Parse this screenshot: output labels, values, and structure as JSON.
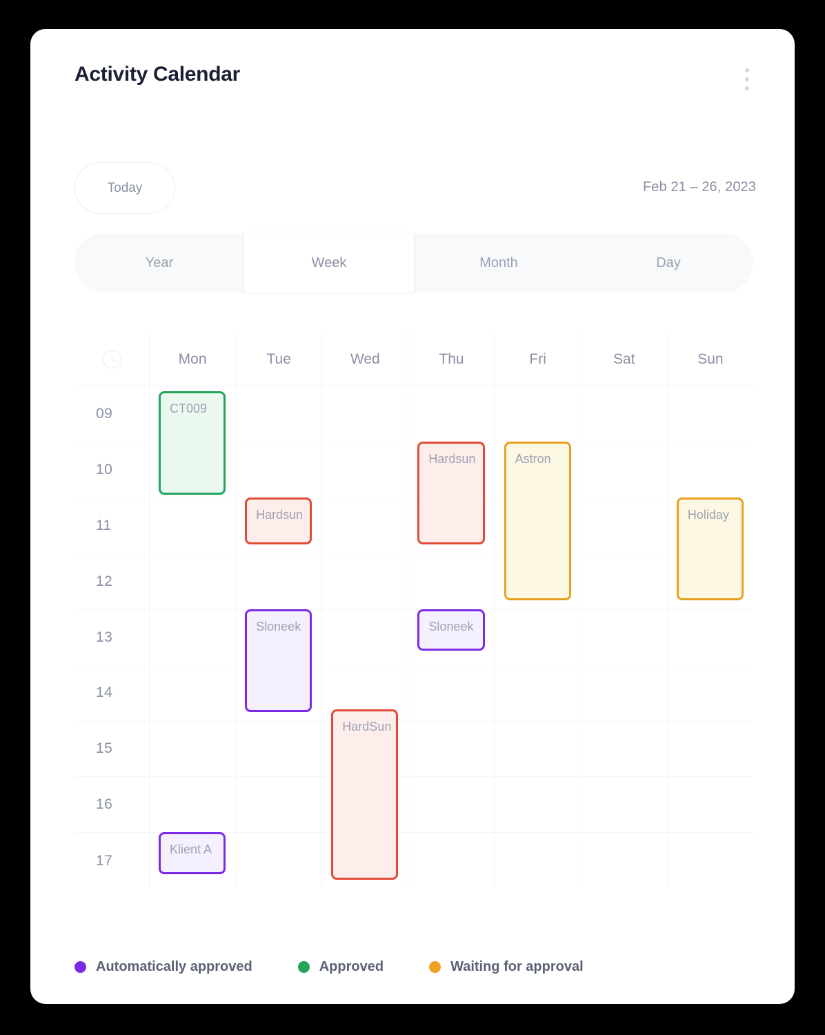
{
  "header": {
    "title": "Activity Calendar",
    "menu_icon": "kebab-vertical-icon"
  },
  "toolbar": {
    "today_label": "Today",
    "date_range": "Feb 21 – 26, 2023"
  },
  "view_tabs": {
    "active": "Week",
    "items": [
      {
        "label": "Year"
      },
      {
        "label": "Week"
      },
      {
        "label": "Month"
      },
      {
        "label": "Day"
      }
    ]
  },
  "calendar": {
    "clock_icon": "clock-icon",
    "days": [
      "Mon",
      "Tue",
      "Wed",
      "Thu",
      "Fri",
      "Sat",
      "Sun"
    ],
    "hours": [
      "09",
      "10",
      "11",
      "12",
      "13",
      "14",
      "15",
      "16",
      "17"
    ],
    "events": [
      {
        "title": "CT009",
        "day": "Mon",
        "day_index": 0,
        "start": 9.0,
        "end": 10.85,
        "status": "approved"
      },
      {
        "title": "Klient A",
        "day": "Mon",
        "day_index": 0,
        "start": 16.9,
        "end": 17.65,
        "status": "automatically_approved"
      },
      {
        "title": "Hardsun",
        "day": "Tue",
        "day_index": 1,
        "start": 10.9,
        "end": 11.75,
        "status": "rejected"
      },
      {
        "title": "Sloneek",
        "day": "Tue",
        "day_index": 1,
        "start": 12.9,
        "end": 14.75,
        "status": "automatically_approved"
      },
      {
        "title": "HardSun",
        "day": "Wed",
        "day_index": 2,
        "start": 14.7,
        "end": 17.75,
        "status": "rejected"
      },
      {
        "title": "Hardsun",
        "day": "Thu",
        "day_index": 3,
        "start": 9.9,
        "end": 11.75,
        "status": "rejected"
      },
      {
        "title": "Sloneek",
        "day": "Thu",
        "day_index": 3,
        "start": 12.9,
        "end": 13.65,
        "status": "automatically_approved"
      },
      {
        "title": "Astron",
        "day": "Fri",
        "day_index": 4,
        "start": 9.9,
        "end": 12.75,
        "status": "waiting"
      },
      {
        "title": "Holiday",
        "day": "Sun",
        "day_index": 6,
        "start": 10.9,
        "end": 12.75,
        "status": "waiting"
      }
    ]
  },
  "legend": {
    "items": [
      {
        "label": "Automatically approved",
        "color": "#7c2ae8"
      },
      {
        "label": "Approved",
        "color": "#22a45d"
      },
      {
        "label": "Waiting for approval",
        "color": "#f0a020"
      }
    ]
  },
  "status_colors": {
    "approved": {
      "border": "#22a45d",
      "fill": "#eaf8f0"
    },
    "automatically_approved": {
      "border": "#7c2ae8",
      "fill": "#f5f0fd"
    },
    "waiting": {
      "border": "#e8a020",
      "fill": "#fdf8e4"
    },
    "rejected": {
      "border": "#e04b35",
      "fill": "#fdeeec"
    }
  }
}
